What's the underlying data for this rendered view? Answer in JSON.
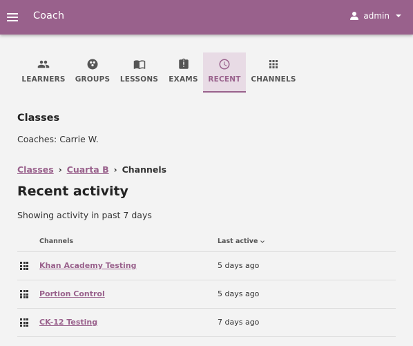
{
  "appbar": {
    "title": "Coach",
    "user": "admin",
    "accent": "#99618c"
  },
  "tabs": [
    {
      "label": "LEARNERS",
      "icon": "people-icon",
      "active": false
    },
    {
      "label": "GROUPS",
      "icon": "groups-icon",
      "active": false
    },
    {
      "label": "LESSONS",
      "icon": "book-icon",
      "active": false
    },
    {
      "label": "EXAMS",
      "icon": "exam-icon",
      "active": false
    },
    {
      "label": "RECENT",
      "icon": "clock-icon",
      "active": true
    },
    {
      "label": "CHANNELS",
      "icon": "apps-grid-icon",
      "active": false
    }
  ],
  "classes": {
    "title": "Classes",
    "coaches": "Coaches: Carrie W."
  },
  "breadcrumb": {
    "items": [
      "Classes",
      "Cuarta B"
    ],
    "current": "Channels",
    "separator": "›"
  },
  "page": {
    "title": "Recent activity",
    "subtitle": "Showing activity in past 7 days"
  },
  "table": {
    "headers": {
      "channels": "Channels",
      "last_active": "Last active"
    },
    "rows": [
      {
        "channel": "Khan Academy Testing",
        "last_active": "5 days ago"
      },
      {
        "channel": "Portion Control",
        "last_active": "5 days ago"
      },
      {
        "channel": "CK-12 Testing",
        "last_active": "7 days ago"
      }
    ]
  }
}
